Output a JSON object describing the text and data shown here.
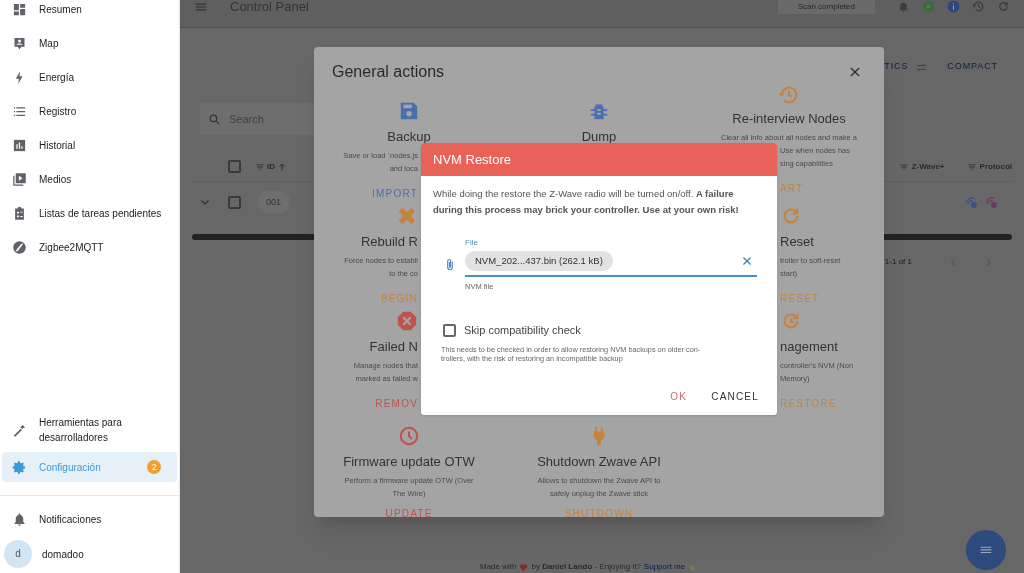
{
  "sidebar": {
    "items": [
      {
        "label": "Resumen",
        "selected": false
      },
      {
        "label": "Map",
        "selected": false
      },
      {
        "label": "Energía",
        "selected": false
      },
      {
        "label": "Registro",
        "selected": false
      },
      {
        "label": "Historial",
        "selected": false
      },
      {
        "label": "Medios",
        "selected": false
      },
      {
        "label": "Listas de tareas pendientes",
        "selected": false
      },
      {
        "label": "Zigbee2MQTT",
        "selected": false
      }
    ],
    "bottom_items": [
      {
        "label": "Herramientas para desarrolladores",
        "selected": false
      },
      {
        "label": "Configuración",
        "selected": true,
        "badge": "2"
      }
    ],
    "notifications": "Notificaciones",
    "user": {
      "avatar": "d",
      "name": "domadoo"
    }
  },
  "topbar": {
    "title": "Control Panel",
    "status": "Scan completed"
  },
  "view_links": [
    "TICS",
    "COMPACT"
  ],
  "search": {
    "placeholder": "Search"
  },
  "table": {
    "all_selected": false,
    "columns_left": [
      "ID"
    ],
    "columns_right": [
      "Z-Wave+",
      "Protocol"
    ],
    "rows": [
      {
        "id": "001",
        "checked": false
      }
    ],
    "pagination": "1-1 of 1"
  },
  "footer": {
    "text": "Made with",
    "credit": "by **Daniel Lando** - Enjoying it?",
    "link": "Support me"
  },
  "general_actions": {
    "title": "General actions",
    "actions": [
      {
        "title": "Backup",
        "description": [
          "Save or load `nodes.js",
          "and loca"
        ],
        "button": "IMPORT",
        "color": "#4a6fae"
      },
      {
        "title": "Dump",
        "color": "#4a6fae"
      },
      {
        "title": "Re-interview Nodes",
        "description": [
          "Clear all info about all nodes and make a",
          "Use when nodes has",
          "sing capabilities"
        ],
        "button": "ART",
        "color": "#c4833f"
      },
      {
        "title": "Rebuild R",
        "description": [
          "Force nodes to establi",
          "to the co"
        ],
        "button": "BEGIN",
        "color": "#c4833f"
      },
      {
        "title": "Reset",
        "description": [
          "troller to soft-reset",
          "start)"
        ],
        "button": "RESET",
        "color": "#c4833f"
      },
      {
        "title": "Failed N",
        "description": [
          "Manage nodes that",
          "marked as failed w"
        ],
        "button": "REMOV",
        "color": "#c0524d"
      },
      {
        "title": "nagement",
        "description": [
          "controller's NVM (Non",
          "Memory)"
        ],
        "button": "RESTORE",
        "color": "#c4833f"
      },
      {
        "title": "Firmware update OTW",
        "description": [
          "Perform a firmware update OTW (Over",
          "The Wire)"
        ],
        "button": "UPDATE",
        "color": "#c0524d"
      },
      {
        "title": "Shutdown Zwave API",
        "description": [
          "Allows to shutdown the Zwave API to",
          "safely unplug the Zwave stick"
        ],
        "button": "SHUTDOWN",
        "color": "#c4833f"
      }
    ]
  },
  "nvm_dialog": {
    "title": "NVM Restore",
    "message": "While doing the restore the Z-Wave radio will be turned on/off. **A failure during this process may brick your controller. Use at your own risk!**",
    "file": {
      "label": "File",
      "value": "NVM_202...437.bin (262.1 kB)",
      "hint": "NVM file"
    },
    "skip_check": {
      "label": "Skip compatibility check",
      "checked": false,
      "help": [
        "This needs to be checked in order to allow restoring NVM backups on older con-",
        "trollers, with the risk of restoring an incompatible backup"
      ]
    },
    "buttons": [
      {
        "label": "OK",
        "kind": "primary"
      },
      {
        "label": "CANCEL",
        "kind": "secondary"
      }
    ]
  }
}
